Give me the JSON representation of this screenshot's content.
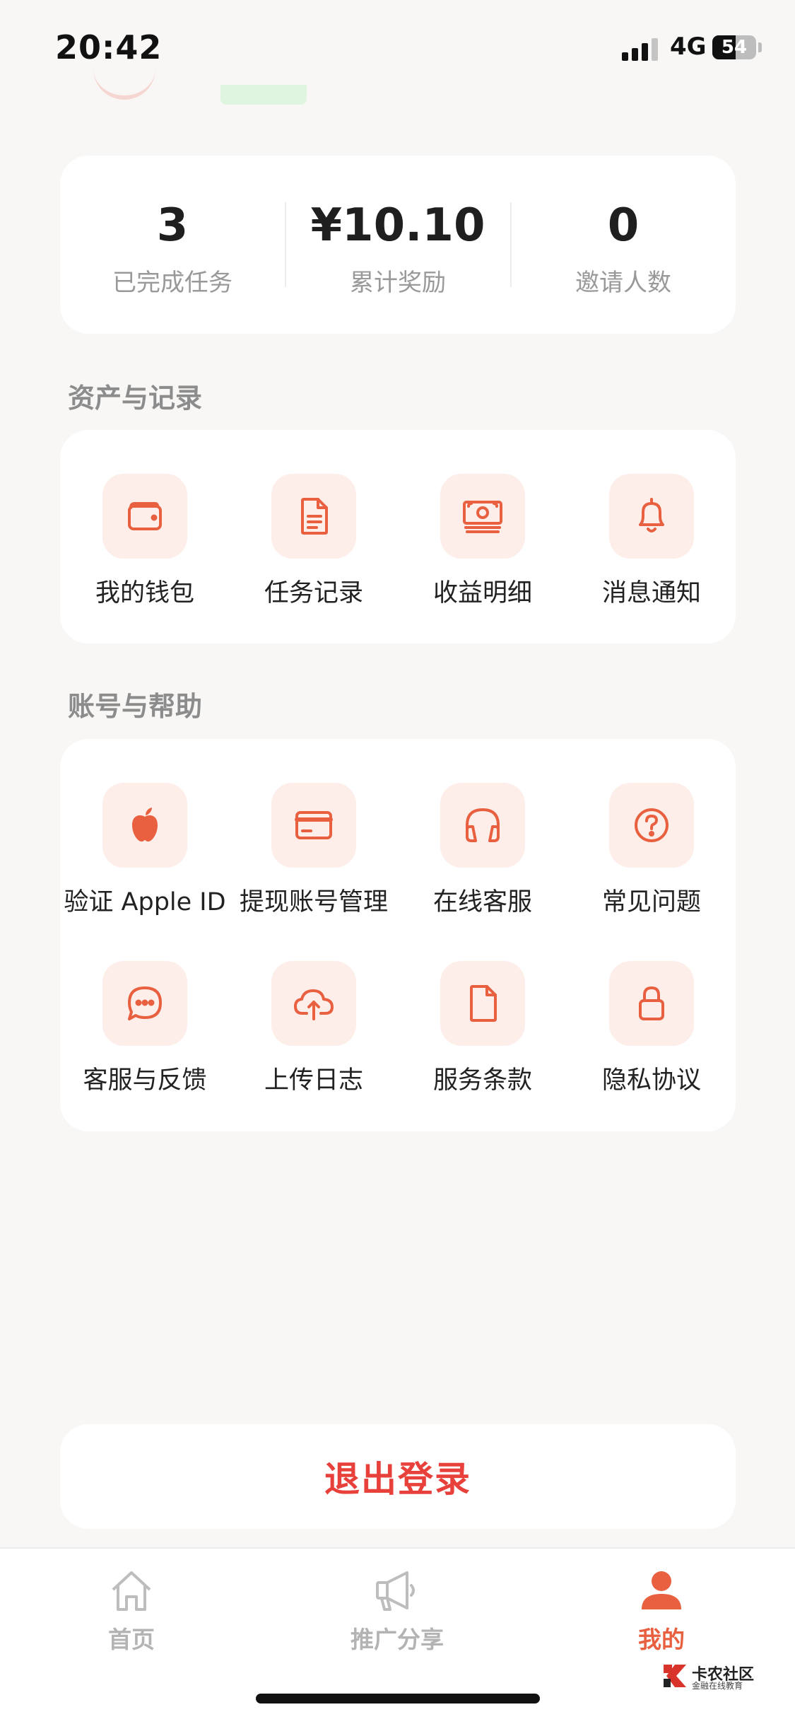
{
  "status_bar": {
    "time": "20:42",
    "network": "4G",
    "battery": "54",
    "battery_level": 0.54
  },
  "stats": [
    {
      "value": "3",
      "label": "已完成任务"
    },
    {
      "value": "¥10.10",
      "label": "累计奖励"
    },
    {
      "value": "0",
      "label": "邀请人数"
    }
  ],
  "assets_section": {
    "title": "资产与记录",
    "items": [
      {
        "label": "我的钱包",
        "icon": "wallet-icon"
      },
      {
        "label": "任务记录",
        "icon": "document-list-icon"
      },
      {
        "label": "收益明细",
        "icon": "cash-icon"
      },
      {
        "label": "消息通知",
        "icon": "bell-icon"
      }
    ]
  },
  "account_section": {
    "title": "账号与帮助",
    "items": [
      {
        "label": "验证 Apple ID",
        "icon": "apple-icon"
      },
      {
        "label": "提现账号管理",
        "icon": "credit-card-icon"
      },
      {
        "label": "在线客服",
        "icon": "headphones-icon"
      },
      {
        "label": "常见问题",
        "icon": "question-circle-icon"
      },
      {
        "label": "客服与反馈",
        "icon": "chat-bubble-icon"
      },
      {
        "label": "上传日志",
        "icon": "cloud-upload-icon"
      },
      {
        "label": "服务条款",
        "icon": "file-icon"
      },
      {
        "label": "隐私协议",
        "icon": "lock-icon"
      }
    ]
  },
  "logout": {
    "label": "退出登录"
  },
  "tabbar": {
    "tabs": [
      {
        "label": "首页",
        "icon": "home-icon",
        "active": false
      },
      {
        "label": "推广分享",
        "icon": "megaphone-icon",
        "active": false
      },
      {
        "label": "我的",
        "icon": "person-icon",
        "active": true
      }
    ]
  },
  "watermark": {
    "title": "卡农社区",
    "subtitle": "金融在线教育"
  },
  "colors": {
    "accent": "#e8603f",
    "icon_bg": "#fdeeea",
    "logout_text": "#e8403a",
    "background": "#f8f7f5"
  }
}
